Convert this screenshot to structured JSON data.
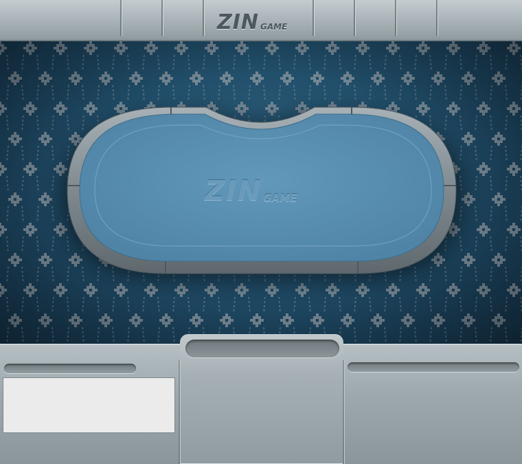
{
  "header": {
    "logo_main": "ZIN",
    "logo_sub": "GAME"
  },
  "table": {
    "logo_main": "ZIN",
    "logo_sub": "GAME",
    "felt_color": "#5b8fb0",
    "rail_color": "#8e989d"
  },
  "carpet": {
    "base_color": "#1f4b66",
    "pattern_color": "#8d98a0"
  },
  "bottom_panel": {
    "chat_text": ""
  }
}
